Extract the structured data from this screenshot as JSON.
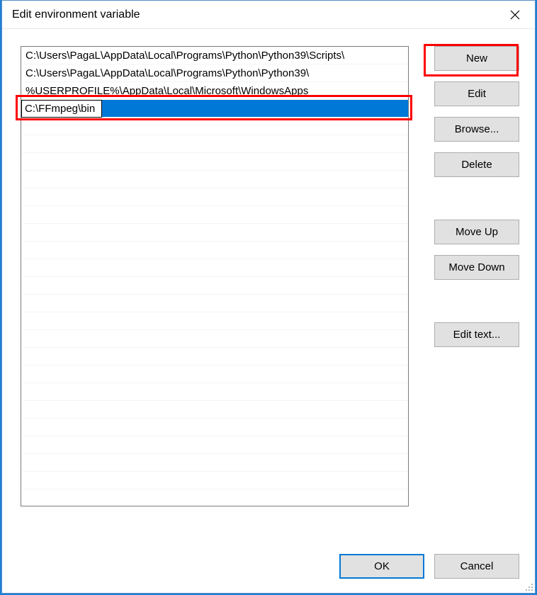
{
  "window": {
    "title": "Edit environment variable"
  },
  "list": {
    "items": [
      "C:\\Users\\PagaL\\AppData\\Local\\Programs\\Python\\Python39\\Scripts\\",
      "C:\\Users\\PagaL\\AppData\\Local\\Programs\\Python\\Python39\\",
      "%USERPROFILE%\\AppData\\Local\\Microsoft\\WindowsApps"
    ],
    "editing_value": "C:\\FFmpeg\\bin"
  },
  "buttons": {
    "new": "New",
    "edit": "Edit",
    "browse": "Browse...",
    "delete": "Delete",
    "move_up": "Move Up",
    "move_down": "Move Down",
    "edit_text": "Edit text...",
    "ok": "OK",
    "cancel": "Cancel"
  }
}
